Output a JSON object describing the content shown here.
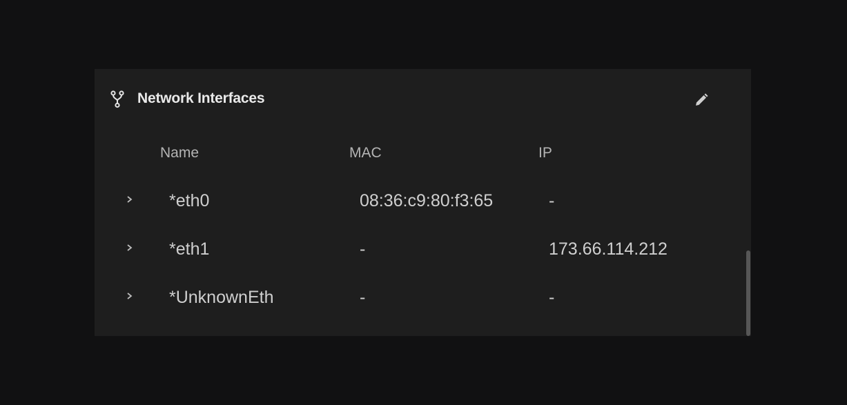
{
  "panel": {
    "title": "Network Interfaces",
    "header_icon": "fork-icon",
    "edit_icon": "pencil-icon"
  },
  "table": {
    "columns": [
      "Name",
      "MAC",
      "IP"
    ],
    "rows": [
      {
        "name": "*eth0",
        "mac": "08:36:c9:80:f3:65",
        "ip": "-"
      },
      {
        "name": "*eth1",
        "mac": "-",
        "ip": "173.66.114.212"
      },
      {
        "name": "*UnknownEth",
        "mac": "-",
        "ip": "-"
      }
    ]
  },
  "colors": {
    "page_background": "#111112",
    "panel_background": "#1e1e1e",
    "title_text": "#eaeaea",
    "body_text": "#cfcfcf",
    "scrollbar": "#565656"
  }
}
